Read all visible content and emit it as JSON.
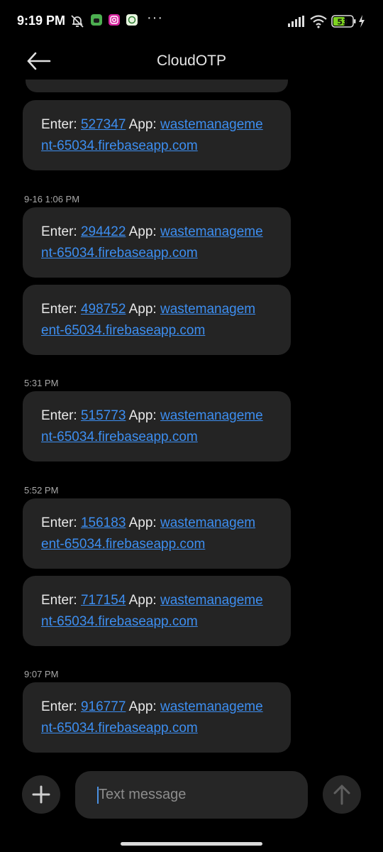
{
  "status_bar": {
    "time": "9:19 PM",
    "battery": "53",
    "more_dots": "···",
    "icons": [
      "bell-off-icon",
      "android-app-icon",
      "instagram-icon",
      "whatsapp-app-icon",
      "signal-icon",
      "wifi-icon",
      "battery-icon",
      "charging-icon"
    ]
  },
  "header": {
    "title": "CloudOTP",
    "back_icon": "back-arrow-icon"
  },
  "messages": [
    {
      "prefix": "Enter: ",
      "code": "527347",
      "mid": " App: ",
      "url_line1": "wastemanageme",
      "url_line2": "nt-65034.firebaseapp.com"
    },
    {
      "prefix": "Enter: ",
      "code": "294422",
      "mid": " App: ",
      "url_line1": "wastemanageme",
      "url_line2": "nt-65034.firebaseapp.com"
    },
    {
      "prefix": "Enter: ",
      "code": "498752",
      "mid": " App: ",
      "url_line1": "wastemanagem",
      "url_line2": "ent-65034.firebaseapp.com"
    },
    {
      "prefix": "Enter: ",
      "code": "515773",
      "mid": " App: ",
      "url_line1": "wastemanageme",
      "url_line2": "nt-65034.firebaseapp.com"
    },
    {
      "prefix": "Enter: ",
      "code": "156183",
      "mid": " App: ",
      "url_line1": "wastemanagem",
      "url_line2": "ent-65034.firebaseapp.com"
    },
    {
      "prefix": "Enter: ",
      "code": "717154",
      "mid": " App: ",
      "url_line1": "wastemanageme",
      "url_line2": "nt-65034.firebaseapp.com"
    },
    {
      "prefix": "Enter: ",
      "code": "916777",
      "mid": " App: ",
      "url_line1": "wastemanageme",
      "url_line2": "nt-65034.firebaseapp.com"
    }
  ],
  "timestamps": [
    "9-16 1:06 PM",
    "5:31 PM",
    "5:52 PM",
    "9:07 PM"
  ],
  "composer": {
    "placeholder": "Text message",
    "add_icon": "plus-icon",
    "send_icon": "send-arrow-icon"
  },
  "colors": {
    "link": "#3d8ef0",
    "bubble": "#242424",
    "background": "#000000",
    "battery_fill": "#7ed321"
  }
}
